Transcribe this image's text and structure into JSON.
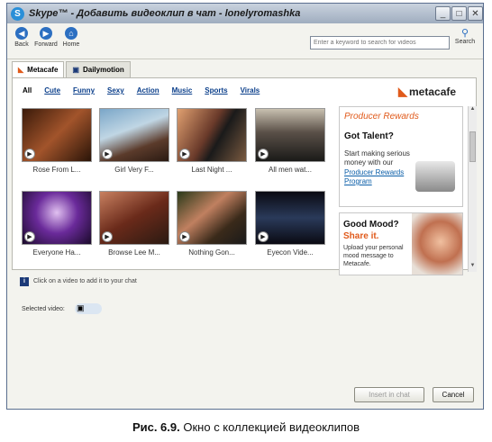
{
  "window": {
    "title": "Skype™ - Добавить видеоклип в чат - lonelyromashka"
  },
  "toolbar": {
    "back_label": "Back",
    "forward_label": "Forward",
    "home_label": "Home",
    "search_placeholder": "Enter a keyword to search for videos",
    "search_label": "Search"
  },
  "tabs": [
    {
      "label": "Metacafe",
      "active": true
    },
    {
      "label": "Dailymotion",
      "active": false
    }
  ],
  "categories": [
    "All",
    "Cute",
    "Funny",
    "Sexy",
    "Action",
    "Music",
    "Sports",
    "Virals"
  ],
  "logo_text": "metacafe",
  "videos": [
    {
      "title": "Rose From L...",
      "icon": "thumbnail-image"
    },
    {
      "title": "Girl Very F...",
      "icon": "thumbnail-image"
    },
    {
      "title": "Last Night ...",
      "icon": "thumbnail-image"
    },
    {
      "title": "All men wat...",
      "icon": "thumbnail-image"
    },
    {
      "title": "Everyone Ha...",
      "icon": "thumbnail-image"
    },
    {
      "title": "Browse Lee M...",
      "icon": "thumbnail-image"
    },
    {
      "title": "Nothing Gon...",
      "icon": "thumbnail-image"
    },
    {
      "title": "Eyecon Vide...",
      "icon": "thumbnail-image"
    }
  ],
  "ads": {
    "producer": {
      "header": "Producer Rewards",
      "headline": "Got Talent?",
      "body": "Start making serious money with our",
      "link": "Producer Rewards Program"
    },
    "mood": {
      "headline1": "Good Mood?",
      "headline2": "Share it.",
      "body": "Upload your personal mood message to Metacafe."
    }
  },
  "hint_text": "Click on a video to add it to your chat",
  "selected_label": "Selected video:",
  "buttons": {
    "insert": "Insert in chat",
    "cancel": "Cancel"
  },
  "figure_caption": {
    "label": "Рис. 6.9.",
    "text": "Окно с коллекцией видеоклипов"
  },
  "colors": {
    "accent": "#e05a1b",
    "link": "#0a3e8a",
    "titlebar": "#9fadbf"
  }
}
